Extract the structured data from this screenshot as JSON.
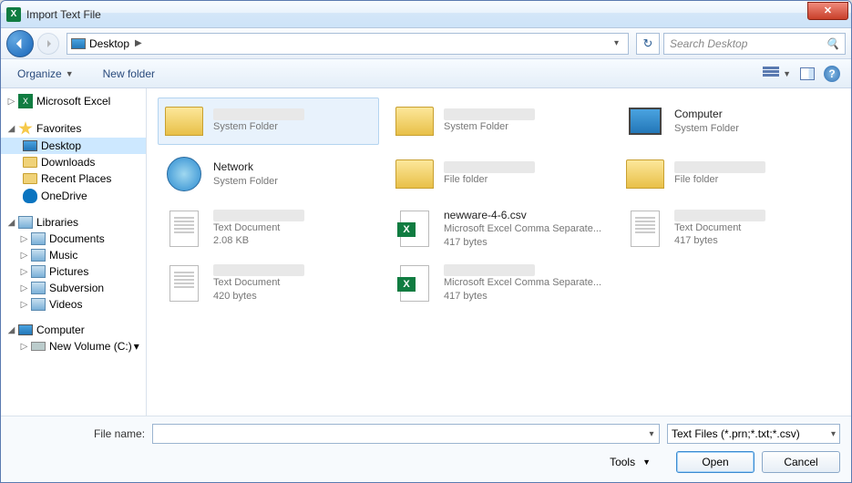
{
  "window": {
    "title": "Import Text File"
  },
  "nav": {
    "location": "Desktop",
    "search_placeholder": "Search Desktop"
  },
  "toolbar": {
    "organize": "Organize",
    "newfolder": "New folder"
  },
  "tree": {
    "excel": "Microsoft Excel",
    "favorites": "Favorites",
    "fav_items": [
      "Desktop",
      "Downloads",
      "Recent Places",
      "OneDrive"
    ],
    "libraries": "Libraries",
    "lib_items": [
      "Documents",
      "Music",
      "Pictures",
      "Subversion",
      "Videos"
    ],
    "computer": "Computer",
    "comp_items": [
      "New Volume (C:)"
    ]
  },
  "tiles": [
    {
      "name": "",
      "sub1": "System Folder",
      "sub2": "",
      "icon": "folder-user",
      "selected": true,
      "blur": true
    },
    {
      "name": "",
      "sub1": "System Folder",
      "sub2": "",
      "icon": "folder-user",
      "blur": true
    },
    {
      "name": "Computer",
      "sub1": "System Folder",
      "sub2": "",
      "icon": "computer"
    },
    {
      "name": "Network",
      "sub1": "System Folder",
      "sub2": "",
      "icon": "network"
    },
    {
      "name": "",
      "sub1": "File folder",
      "sub2": "",
      "icon": "folder",
      "blur": true
    },
    {
      "name": "",
      "sub1": "File folder",
      "sub2": "",
      "icon": "folder",
      "blur": true
    },
    {
      "name": "",
      "sub1": "Text Document",
      "sub2": "2.08 KB",
      "icon": "txt",
      "blur": true
    },
    {
      "name": "newware-4-6.csv",
      "sub1": "Microsoft Excel Comma Separate...",
      "sub2": "417 bytes",
      "icon": "csv"
    },
    {
      "name": "",
      "sub1": "Text Document",
      "sub2": "417 bytes",
      "icon": "txt",
      "blur": true
    },
    {
      "name": "",
      "sub1": "Text Document",
      "sub2": "420 bytes",
      "icon": "txt",
      "blur": true
    },
    {
      "name": "",
      "sub1": "Microsoft Excel Comma Separate...",
      "sub2": "417 bytes",
      "icon": "csv",
      "blur": true
    }
  ],
  "footer": {
    "filename_label": "File name:",
    "filename_value": "",
    "filter": "Text Files (*.prn;*.txt;*.csv)",
    "tools": "Tools",
    "open": "Open",
    "cancel": "Cancel"
  }
}
